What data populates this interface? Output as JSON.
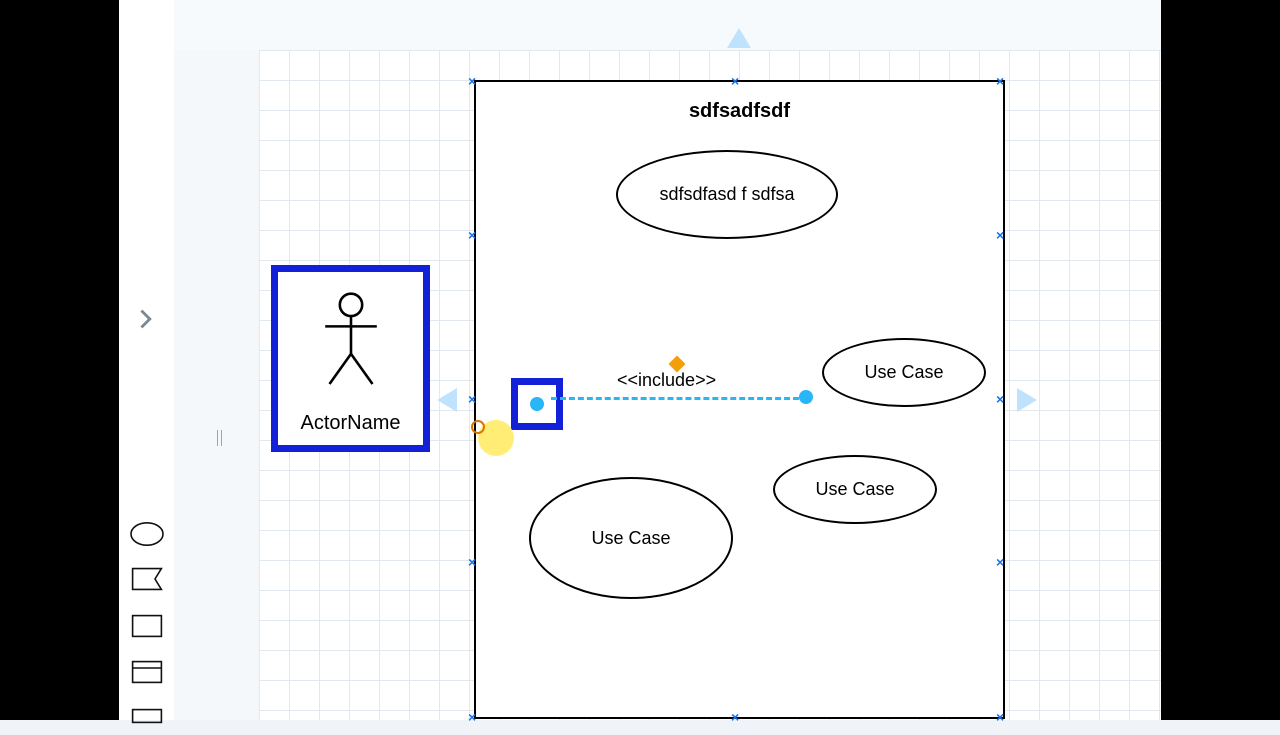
{
  "system": {
    "title": "sdfsadfsdf"
  },
  "usecases": {
    "uc1": "sdfsdfasd f sdfsa",
    "uc2": "Use Case",
    "uc3": "Use Case",
    "uc4": "Use Case"
  },
  "actor": {
    "name": "ActorName"
  },
  "relation": {
    "label": "<<include>>"
  }
}
